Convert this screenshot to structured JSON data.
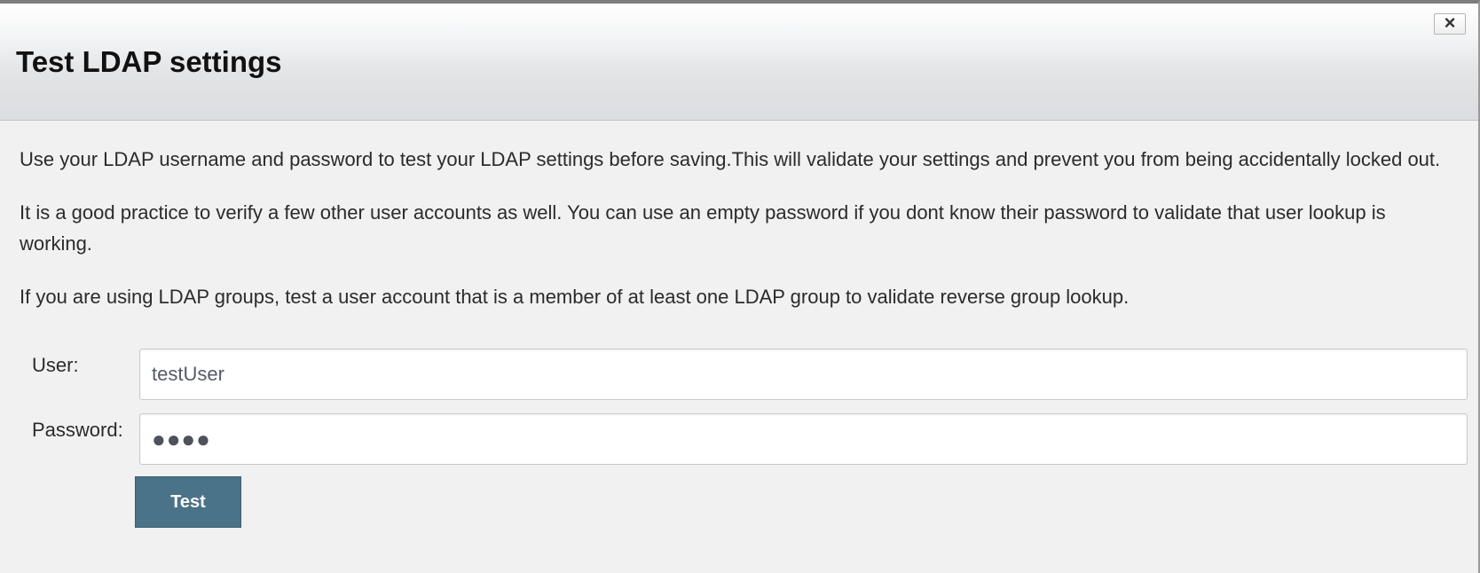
{
  "dialog": {
    "title": "Test LDAP settings",
    "close_label": "×"
  },
  "content": {
    "paragraphs": [
      "Use your LDAP username and password to test your LDAP settings before saving.This will validate your settings and prevent you from being accidentally locked out.",
      "It is a good practice to verify a few other user accounts as well. You can use an empty password if you dont know their password to validate that user lookup is working.",
      "If you are using LDAP groups, test a user account that is a member of at least one LDAP group to validate reverse group lookup."
    ]
  },
  "form": {
    "user_label": "User:",
    "user_value": "testUser",
    "password_label": "Password:",
    "password_value": "●●●●",
    "test_button_label": "Test"
  },
  "icons": {
    "close": "close-icon"
  },
  "colors": {
    "button_bg": "#4a7289",
    "dialog_bg": "#f1f1f1"
  }
}
